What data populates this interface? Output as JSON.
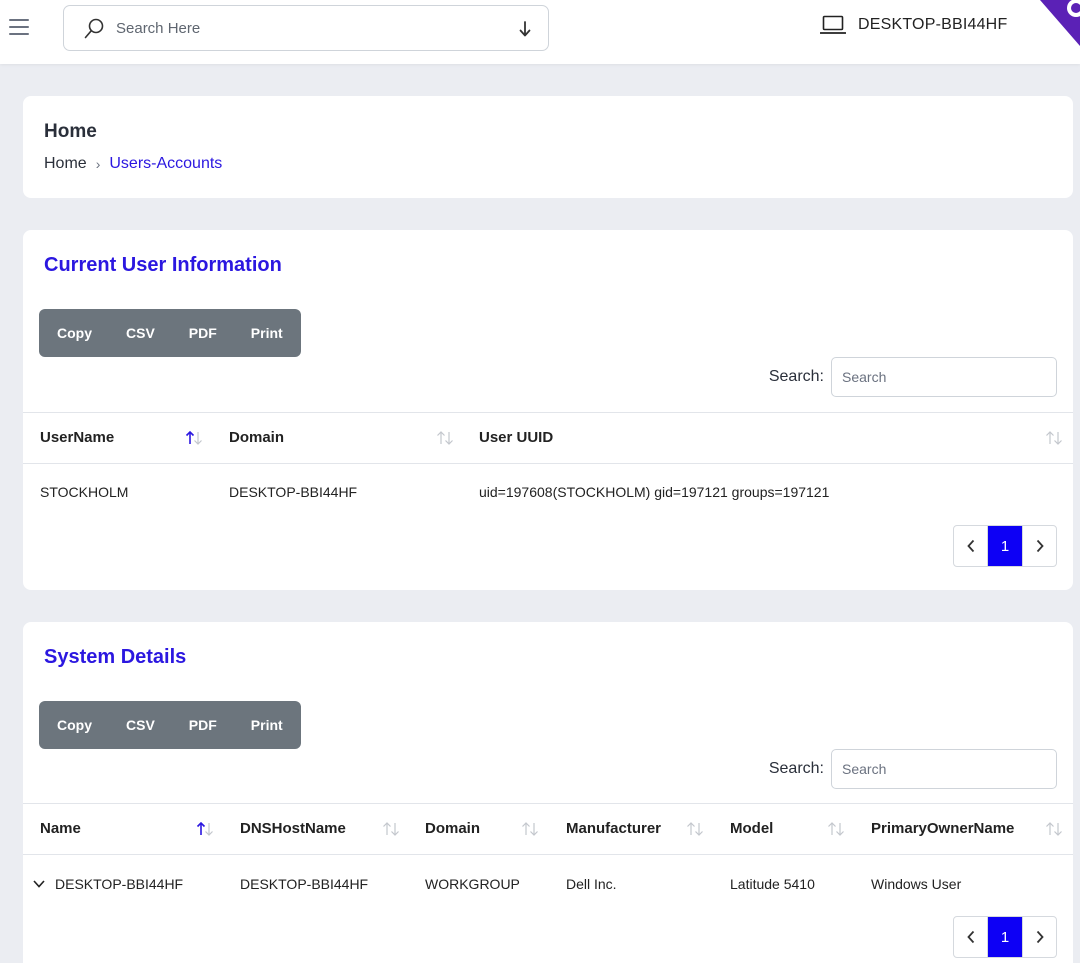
{
  "topbar": {
    "search_placeholder": "Search Here",
    "device_name": "DESKTOP-BBI44HF"
  },
  "header": {
    "title": "Home",
    "breadcrumb": {
      "home": "Home",
      "separator": "›",
      "current": "Users-Accounts"
    }
  },
  "user_info": {
    "title": "Current User Information",
    "buttons": [
      "Copy",
      "CSV",
      "PDF",
      "Print"
    ],
    "search_label": "Search:",
    "search_placeholder": "Search",
    "columns": [
      "UserName",
      "Domain",
      "User UUID"
    ],
    "rows": [
      [
        "STOCKHOLM",
        "DESKTOP-BBI44HF",
        "uid=197608(STOCKHOLM) gid=197121 groups=197121"
      ]
    ],
    "page": "1"
  },
  "system_details": {
    "title": "System Details",
    "buttons": [
      "Copy",
      "CSV",
      "PDF",
      "Print"
    ],
    "search_label": "Search:",
    "search_placeholder": "Search",
    "columns": [
      "Name",
      "DNSHostName",
      "Domain",
      "Manufacturer",
      "Model",
      "PrimaryOwnerName"
    ],
    "rows": [
      [
        "DESKTOP-BBI44HF",
        "DESKTOP-BBI44HF",
        "WORKGROUP",
        "Dell Inc.",
        "Latitude 5410",
        "Windows User"
      ]
    ],
    "page": "1"
  },
  "colors": {
    "accent": "#2b17e0",
    "active_page": "#0d00f5",
    "button_group": "#6c757d",
    "background": "#ebedf2"
  }
}
